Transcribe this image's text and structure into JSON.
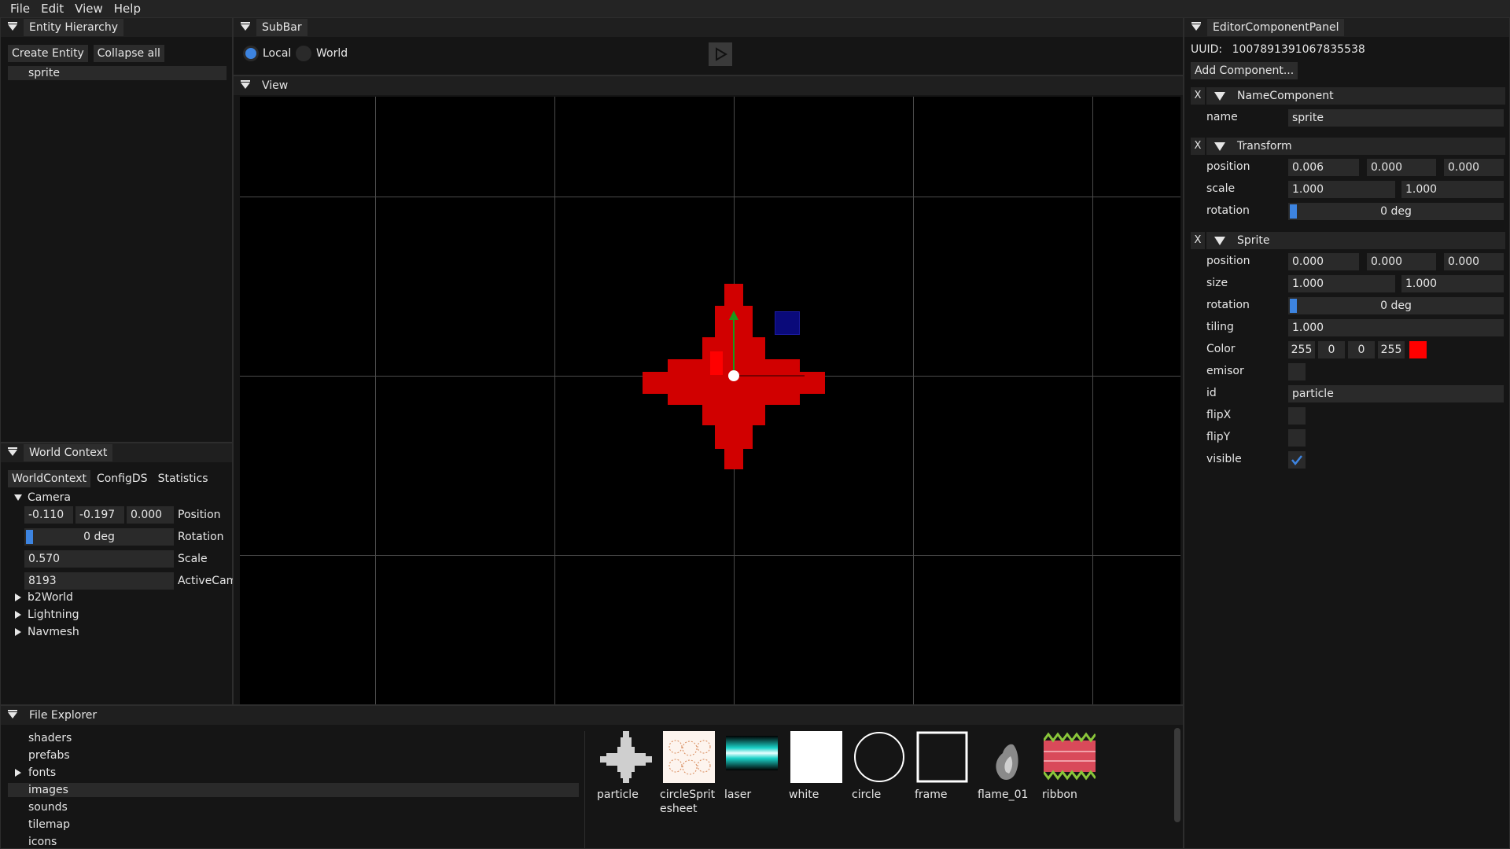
{
  "menu": [
    "File",
    "Edit",
    "View",
    "Help"
  ],
  "hierarchy": {
    "title": "Entity Hierarchy",
    "create_btn": "Create Entity",
    "collapse_btn": "Collapse all",
    "entities": [
      "sprite"
    ]
  },
  "subbar": {
    "title": "SubBar",
    "radio_local": "Local",
    "radio_world": "World",
    "play_icon": "play-icon"
  },
  "view": {
    "title": "View"
  },
  "world_context": {
    "title": "World Context",
    "tabs": [
      "WorldContext",
      "ConfigDS",
      "Statistics"
    ],
    "camera": {
      "label": "Camera",
      "position": [
        "-0.110",
        "-0.197",
        "0.000"
      ],
      "position_label": "Position",
      "rotation": "0 deg",
      "rotation_label": "Rotation",
      "scale": "0.570",
      "scale_label": "Scale",
      "active_cam": "8193",
      "active_cam_label": "ActiveCam"
    },
    "nodes": [
      "b2World",
      "Lightning",
      "Navmesh"
    ]
  },
  "inspector": {
    "title": "EditorComponentPanel",
    "uuid_label": "UUID:",
    "uuid": "1007891391067835538",
    "add_component": "Add Component...",
    "name_component": {
      "title": "NameComponent",
      "name_label": "name",
      "name": "sprite"
    },
    "transform": {
      "title": "Transform",
      "position_label": "position",
      "position": [
        "0.006",
        "0.000",
        "0.000"
      ],
      "scale_label": "scale",
      "scale": [
        "1.000",
        "1.000"
      ],
      "rotation_label": "rotation",
      "rotation": "0 deg"
    },
    "sprite": {
      "title": "Sprite",
      "position_label": "position",
      "position": [
        "0.000",
        "0.000",
        "0.000"
      ],
      "size_label": "size",
      "size": [
        "1.000",
        "1.000"
      ],
      "rotation_label": "rotation",
      "rotation": "0 deg",
      "tiling_label": "tiling",
      "tiling": "1.000",
      "color_label": "Color",
      "color": [
        "255",
        "0",
        "0",
        "255"
      ],
      "color_hex": "#ff0000",
      "emisor_label": "emisor",
      "id_label": "id",
      "id": "particle",
      "flipx_label": "flipX",
      "flipy_label": "flipY",
      "visible_label": "visible",
      "visible": true
    },
    "close_x": "X"
  },
  "file_explorer": {
    "title": "File Explorer",
    "folders": [
      "shaders",
      "prefabs",
      "fonts",
      "images",
      "sounds",
      "tilemap",
      "icons"
    ],
    "selected_folder": "images",
    "files": [
      "particle",
      "circleSprit esheet",
      "laser",
      "white",
      "circle",
      "frame",
      "flame_01",
      "ribbon"
    ]
  },
  "colors": {
    "accent": "#3d84e0",
    "sprite_red": "#d10000",
    "gizmo_green": "#1a9a1a",
    "gizmo_blue": "#0a0a7a"
  }
}
